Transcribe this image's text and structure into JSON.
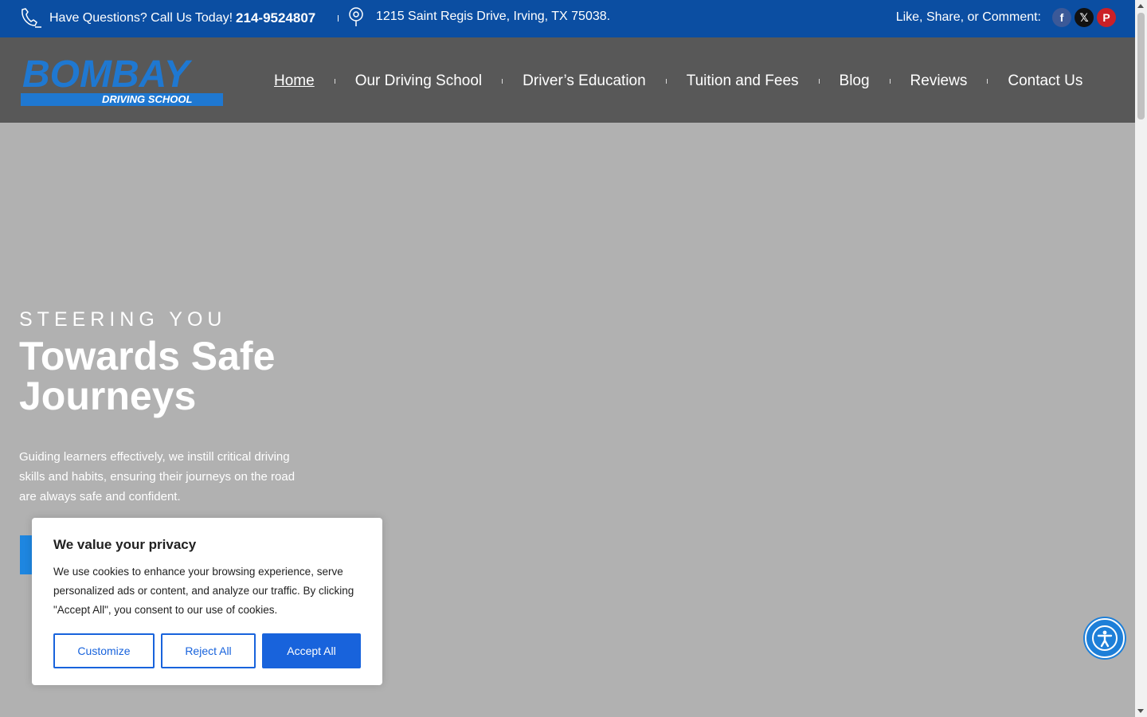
{
  "topbar": {
    "phone_label": "Have Questions? Call Us Today!",
    "phone_number": "214-9524807",
    "address": "1215 Saint Regis Drive, Irving, TX 75038.",
    "social_label": "Like, Share, or Comment:",
    "icons": [
      "phone-icon",
      "location-icon",
      "facebook-icon",
      "x-icon",
      "pinterest-icon"
    ]
  },
  "header": {
    "logo_name": "BOMBAY",
    "logo_sub": "DRIVING SCHOOL",
    "nav": [
      {
        "label": "Home"
      },
      {
        "label": "Our Driving School"
      },
      {
        "label": "Driver’s Education"
      },
      {
        "label": "Tuition and Fees"
      },
      {
        "label": "Blog"
      },
      {
        "label": "Reviews"
      },
      {
        "label": "Contact Us"
      }
    ]
  },
  "hero": {
    "eyebrow": "STEERING YOU",
    "headline": "Towards Safe Journeys",
    "lead": "Guiding learners effectively, we instill critical driving skills and habits, ensuring their journeys on the road are always safe and confident."
  },
  "cookie": {
    "title": "We value your privacy",
    "body": "We use cookies to enhance your browsing experience, serve personalized ads or content, and analyze our traffic. By clicking \"Accept All\", you consent to our use of cookies.",
    "customize": "Customize",
    "reject": "Reject All",
    "accept": "Accept All"
  },
  "colors": {
    "topbar": "#0b4ea2",
    "header": "#585858",
    "hero": "#b1b1b1",
    "accent": "#1863dc"
  }
}
